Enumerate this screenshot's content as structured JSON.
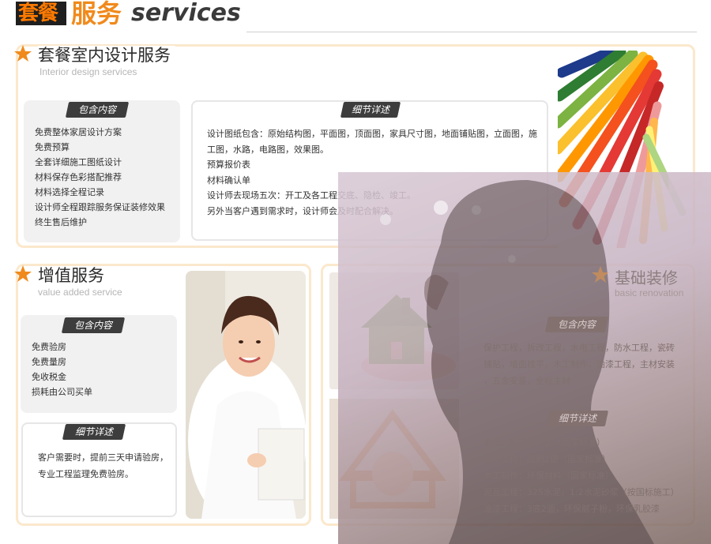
{
  "header": {
    "cn_box": "套餐",
    "cn_main": "服务",
    "en": "services"
  },
  "section1": {
    "title": "套餐室内设计服务",
    "subtitle": "Interior design services",
    "included_label": "包含内容",
    "included_items": [
      "免费整体家居设计方案",
      "免费预算",
      "全套详细施工图纸设计",
      "材料保存色彩搭配推荐",
      "材料选择全程记录",
      "设计师全程跟踪服务保证装修效果",
      "终生售后维护"
    ],
    "details_label": "细节详述",
    "details_lines": [
      "设计图纸包含：原始结构图，平面图，顶面图，家具尺寸图，地面铺贴图，立面图，施",
      "工图，水路，电路图，效果图。",
      "预算报价表",
      "材料确认单",
      "设计师去现场五次：开工及各工程交底、隐检、竣工。",
      "另外当客户遇到需求时，设计师会及时配合解决。"
    ]
  },
  "section2": {
    "title": "增值服务",
    "subtitle": "value added service",
    "included_label": "包含内容",
    "included_items": [
      "免费验房",
      "免费量房",
      "免收税金",
      "损耗由公司买单"
    ],
    "details_label": "细节详述",
    "details_lines": [
      "客户需要时，提前三天申请验房，",
      "专业工程监理免费验房。"
    ]
  },
  "section3": {
    "title": "基础装修",
    "subtitle": "basic renovation",
    "included_label": "包含内容",
    "included_lines": [
      "保护工程，拆改工程，水电工程，防水工程，瓷砖",
      "铺贴，墙面找平，木工制作，油漆工程，主材安装",
      "，五金安装，全程主材"
    ],
    "details_label": "细节详述",
    "details_lines": [
      "水电：经过水安装（国家标准）",
      "防水工程：施刷2便（国家标准）",
      "木工制作：环保材料（国家标准）",
      "泥瓦工程：325水泥，1:2水泥砂浆（按国标施工）",
      "油漆工程：3底2面，环保腻子粉，环保乳胶漆"
    ]
  },
  "colors": {
    "accent_orange": "#f08a1c",
    "frame_border": "#fbe8cc",
    "pill_bg": "#3d3d3d"
  }
}
